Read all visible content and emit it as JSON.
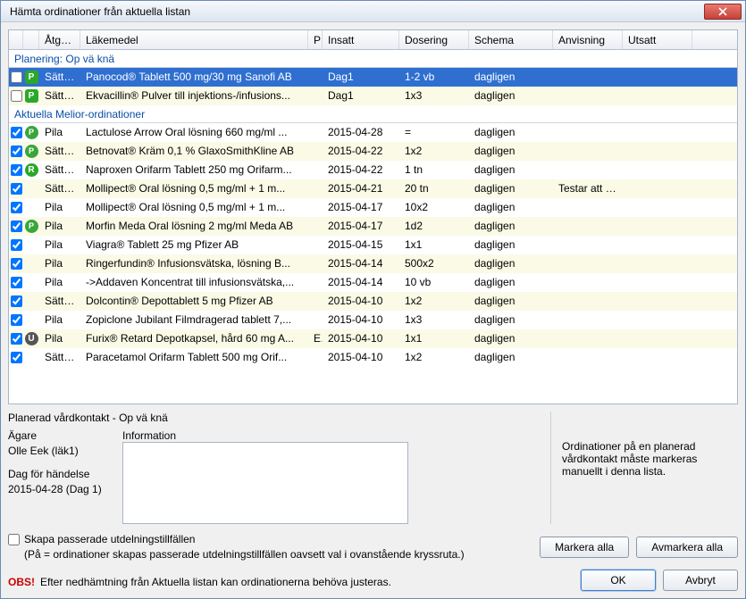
{
  "window": {
    "title": "Hämta ordinationer från aktuella listan"
  },
  "columns": {
    "atgard": "Åtgärd",
    "lakemedel": "Läkemedel",
    "p": "P",
    "insatt": "Insatt",
    "dosering": "Dosering",
    "schema": "Schema",
    "anvisning": "Anvisning",
    "utsatt": "Utsatt"
  },
  "groups": {
    "planering": "Planering: Op vä knä",
    "aktuella": "Aktuella Melior-ordinationer"
  },
  "rows": [
    {
      "group": "planering",
      "checked": false,
      "icon": "P",
      "atg": "Sätt in",
      "lak": "Panocod® Tablett 500 mg/30 mg Sanofi AB",
      "p": "",
      "ins": "Dag1",
      "dos": "1-2 vb",
      "sch": "dagligen",
      "anv": "",
      "selected": true,
      "alt": false
    },
    {
      "group": "planering",
      "checked": false,
      "icon": "P",
      "atg": "Sätt in",
      "lak": "Ekvacillin® Pulver till injektions-/infusions...",
      "p": "",
      "ins": "Dag1",
      "dos": "1x3",
      "sch": "dagligen",
      "anv": "",
      "alt": true
    },
    {
      "group": "aktuella",
      "checked": true,
      "icon": "pill",
      "atg": "Pila",
      "lak": "Lactulose Arrow Oral lösning 660 mg/ml ...",
      "p": "",
      "ins": "2015-04-28",
      "dos": "=",
      "sch": "dagligen",
      "anv": "",
      "alt": false
    },
    {
      "group": "aktuella",
      "checked": true,
      "icon": "pill",
      "atg": "Sätt in",
      "lak": "Betnovat® Kräm 0,1 % GlaxoSmithKline AB",
      "p": "",
      "ins": "2015-04-22",
      "dos": "1x2",
      "sch": "dagligen",
      "anv": "",
      "alt": true
    },
    {
      "group": "aktuella",
      "checked": true,
      "icon": "R",
      "atg": "Sätt in",
      "lak": "Naproxen Orifarm Tablett 250 mg Orifarm...",
      "p": "",
      "ins": "2015-04-22",
      "dos": "1 tn",
      "sch": "dagligen",
      "anv": "",
      "alt": false
    },
    {
      "group": "aktuella",
      "checked": true,
      "icon": "",
      "atg": "Sätt in",
      "lak": "Mollipect® Oral lösning 0,5 mg/ml + 1 m...",
      "p": "",
      "ins": "2015-04-21",
      "dos": "20 tn",
      "sch": "dagligen",
      "anv": "Testar att s...",
      "alt": true
    },
    {
      "group": "aktuella",
      "checked": true,
      "icon": "",
      "atg": "Pila",
      "lak": "Mollipect® Oral lösning 0,5 mg/ml + 1 m...",
      "p": "",
      "ins": "2015-04-17",
      "dos": "10x2",
      "sch": "dagligen",
      "anv": "",
      "alt": false
    },
    {
      "group": "aktuella",
      "checked": true,
      "icon": "pill",
      "atg": "Pila",
      "lak": "Morfin Meda Oral lösning 2 mg/ml Meda AB",
      "p": "",
      "ins": "2015-04-17",
      "dos": "1d2",
      "sch": "dagligen",
      "anv": "",
      "alt": true
    },
    {
      "group": "aktuella",
      "checked": true,
      "icon": "",
      "atg": "Pila",
      "lak": "Viagra® Tablett 25 mg Pfizer AB",
      "p": "",
      "ins": "2015-04-15",
      "dos": "1x1",
      "sch": "dagligen",
      "anv": "",
      "alt": false
    },
    {
      "group": "aktuella",
      "checked": true,
      "icon": "",
      "atg": "Pila",
      "lak": "Ringerfundin® Infusionsvätska, lösning B...",
      "p": "",
      "ins": "2015-04-14",
      "dos": "500x2",
      "sch": "dagligen",
      "anv": "",
      "alt": true
    },
    {
      "group": "aktuella",
      "checked": true,
      "icon": "",
      "atg": "Pila",
      "lak": "->Addaven Koncentrat till infusionsvätska,...",
      "p": "",
      "ins": "2015-04-14",
      "dos": "10 vb",
      "sch": "dagligen",
      "anv": "",
      "alt": false
    },
    {
      "group": "aktuella",
      "checked": true,
      "icon": "",
      "atg": "Sätt in",
      "lak": "Dolcontin® Depottablett 5 mg Pfizer AB",
      "p": "",
      "ins": "2015-04-10",
      "dos": "1x2",
      "sch": "dagligen",
      "anv": "",
      "alt": true
    },
    {
      "group": "aktuella",
      "checked": true,
      "icon": "",
      "atg": "Pila",
      "lak": "Zopiclone Jubilant Filmdragerad tablett 7,...",
      "p": "",
      "ins": "2015-04-10",
      "dos": "1x3",
      "sch": "dagligen",
      "anv": "",
      "alt": false
    },
    {
      "group": "aktuella",
      "checked": true,
      "icon": "U",
      "atg": "Pila",
      "lak": "Furix® Retard Depotkapsel, hård 60 mg A...",
      "p": "E",
      "ins": "2015-04-10",
      "dos": "1x1",
      "sch": "dagligen",
      "anv": "",
      "alt": true
    },
    {
      "group": "aktuella",
      "checked": true,
      "icon": "",
      "atg": "Sätt in",
      "lak": "Paracetamol Orifarm Tablett 500 mg Orif...",
      "p": "",
      "ins": "2015-04-10",
      "dos": "1x2",
      "sch": "dagligen",
      "anv": "",
      "alt": false
    }
  ],
  "details": {
    "title": "Planerad vårdkontakt - Op vä knä",
    "owner_label": "Ägare",
    "owner_value": "Olle Eek (läk1)",
    "day_label": "Dag för händelse",
    "day_value": "2015-04-28 (Dag 1)",
    "info_label": "Information",
    "right_note": "Ordinationer på en planerad vårdkontakt måste markeras manuellt i denna lista."
  },
  "bottom": {
    "chk_label": "Skapa passerade utdelningstillfällen",
    "sub_note": "(På = ordinationer skapas passerade utdelningstillfällen oavsett val i ovanstående kryssruta.)",
    "obs_prefix": "OBS!",
    "obs_text": "Efter nedhämtning från Aktuella listan kan ordinationerna behöva justeras."
  },
  "buttons": {
    "markera_alla": "Markera alla",
    "avmarkera_alla": "Avmarkera alla",
    "ok": "OK",
    "avbryt": "Avbryt"
  }
}
